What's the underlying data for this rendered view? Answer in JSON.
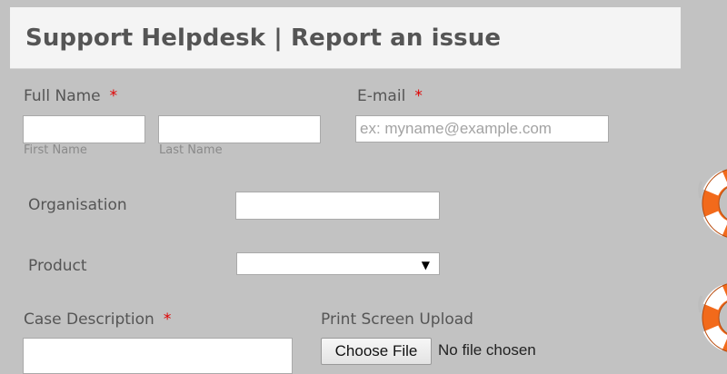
{
  "header": {
    "title": "Support Helpdesk | Report an issue"
  },
  "form": {
    "full_name": {
      "label": "Full Name",
      "required_mark": "*",
      "first_name_sublabel": "First Name",
      "last_name_sublabel": "Last Name",
      "first_name_value": "",
      "last_name_value": ""
    },
    "email": {
      "label": "E-mail",
      "required_mark": "*",
      "placeholder": "ex: myname@example.com",
      "value": ""
    },
    "organisation": {
      "label": "Organisation",
      "value": ""
    },
    "product": {
      "label": "Product",
      "selected": ""
    },
    "case_description": {
      "label": "Case Description",
      "required_mark": "*"
    },
    "print_screen_upload": {
      "label": "Print Screen Upload",
      "button_label": "Choose File",
      "status": "No file chosen"
    }
  },
  "decorations": {
    "icon": "lifebuoy-icon",
    "accent_color": "#f26a1b"
  }
}
